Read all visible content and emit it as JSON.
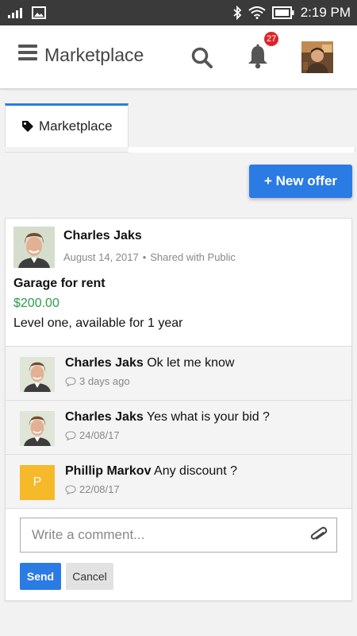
{
  "status_bar": {
    "time": "2:19 PM"
  },
  "app_bar": {
    "title": "Marketplace",
    "notification_count": "27"
  },
  "tabs": [
    {
      "label": "Marketplace"
    }
  ],
  "actions": {
    "new_offer_label": "+ New offer"
  },
  "post": {
    "author": "Charles Jaks",
    "date": "August 14, 2017",
    "separator": "•",
    "visibility": "Shared with Public",
    "title": "Garage for rent",
    "price": "$200.00",
    "description": "Level one, available for 1 year"
  },
  "comments": [
    {
      "author": "Charles Jaks",
      "text": "Ok let me know",
      "time": "3 days ago"
    },
    {
      "author": "Charles Jaks",
      "text": "Yes what is your bid ?",
      "time": "24/08/17"
    },
    {
      "author": "Phillip Markov",
      "text": "Any discount ?",
      "time": "22/08/17",
      "initial": "P"
    }
  ],
  "comment_form": {
    "placeholder": "Write a comment...",
    "send_label": "Send",
    "cancel_label": "Cancel"
  },
  "colors": {
    "accent": "#2a7be4",
    "price": "#2a9d47",
    "badge": "#d9262a",
    "initial_avatar": "#f5b92a",
    "status_bar": "#3a3a3a"
  }
}
